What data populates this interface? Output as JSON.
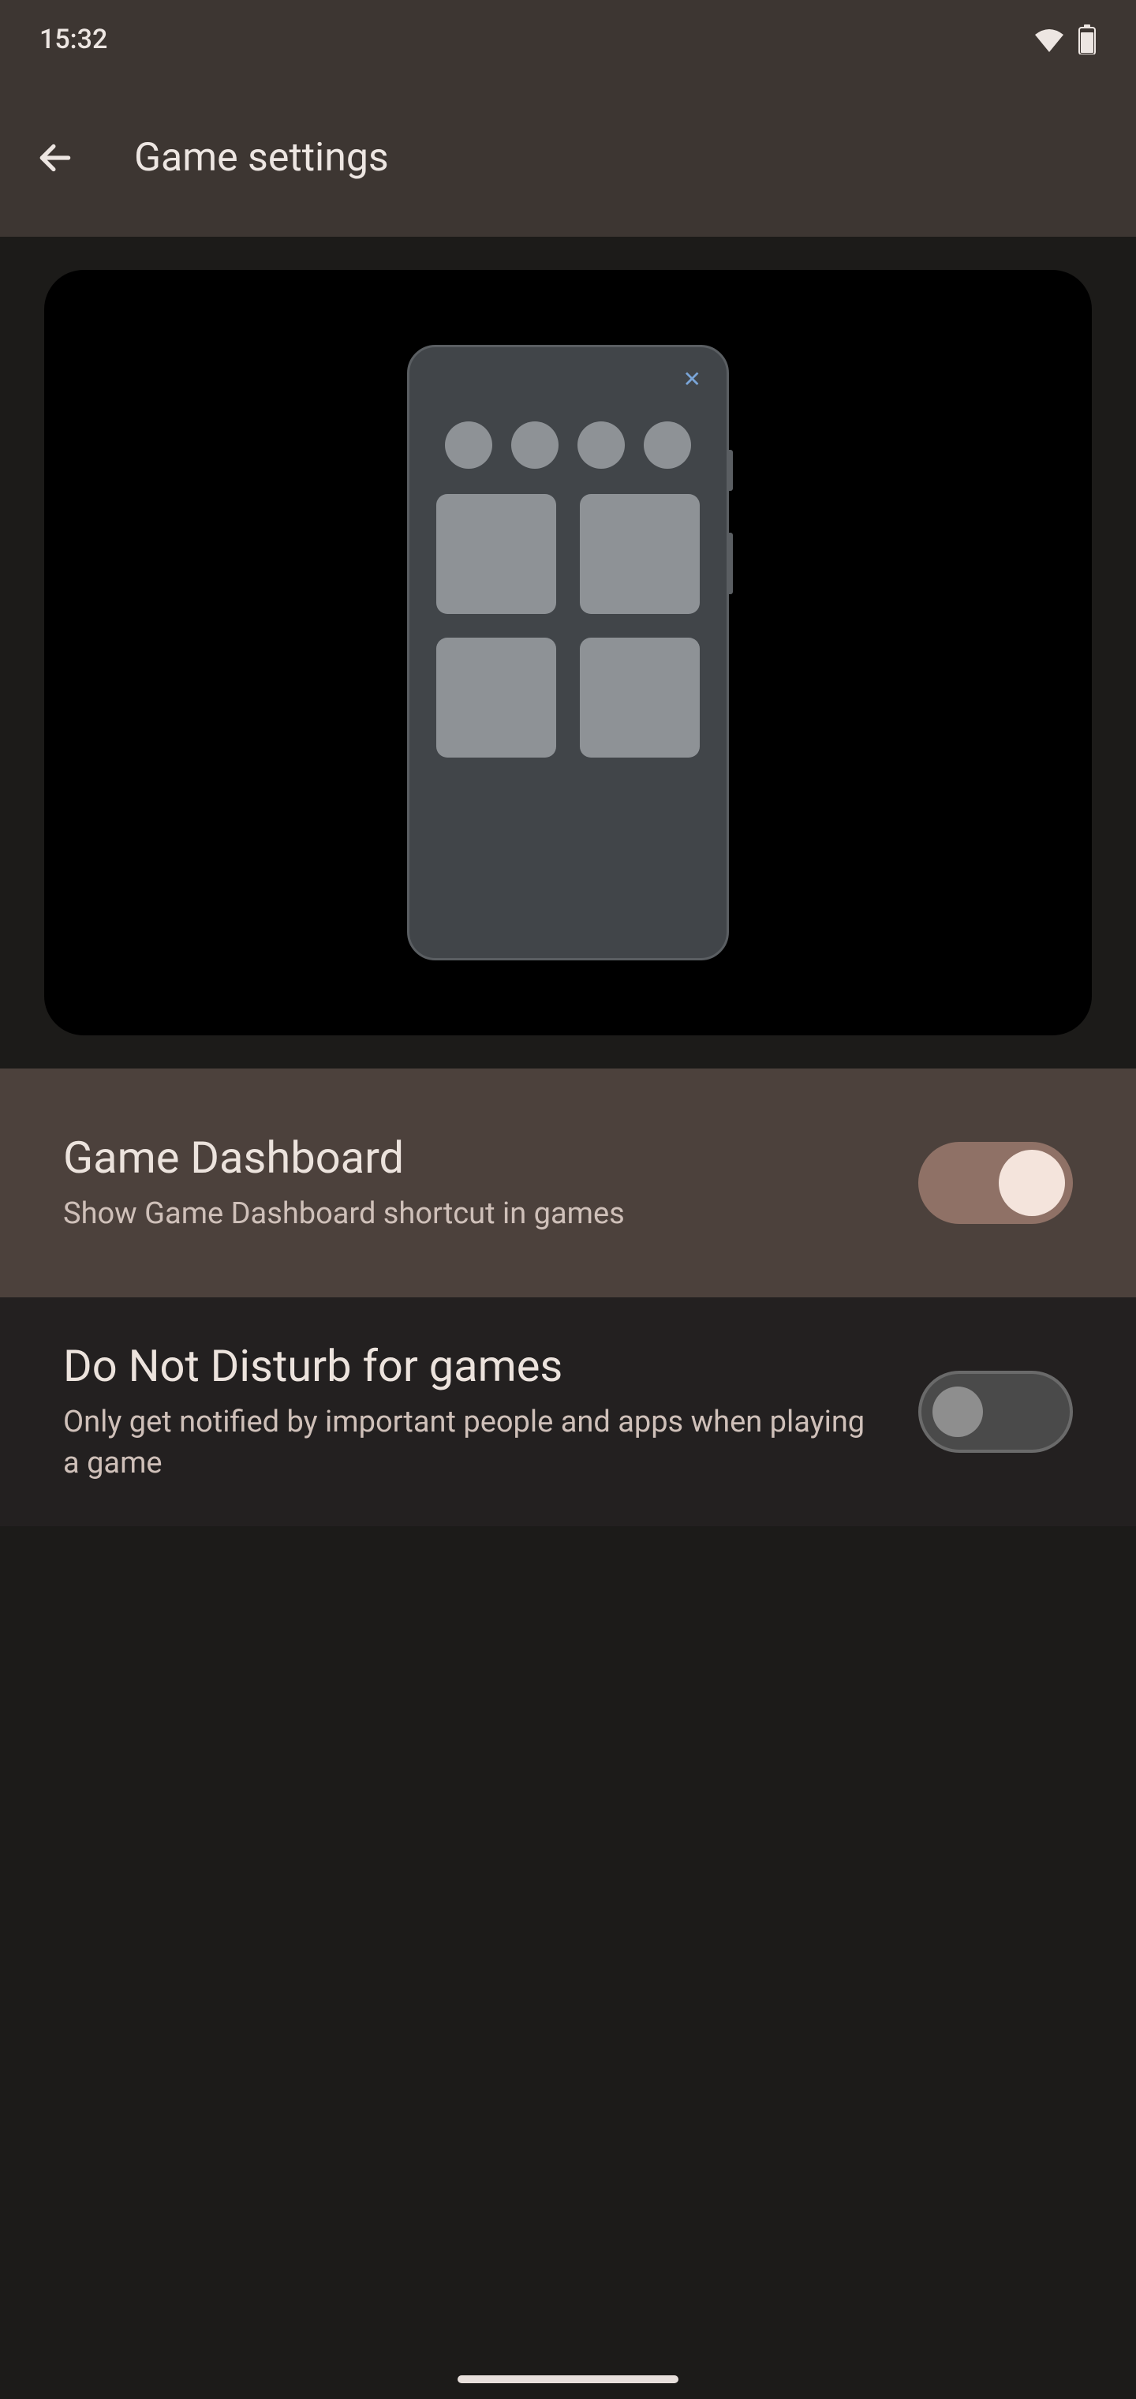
{
  "status": {
    "time": "15:32"
  },
  "header": {
    "title": "Game settings"
  },
  "settings": [
    {
      "title": "Game Dashboard",
      "description": "Show Game Dashboard shortcut in games",
      "enabled": true
    },
    {
      "title": "Do Not Disturb for games",
      "description": "Only get notified by important people and apps when playing a game",
      "enabled": false
    }
  ]
}
